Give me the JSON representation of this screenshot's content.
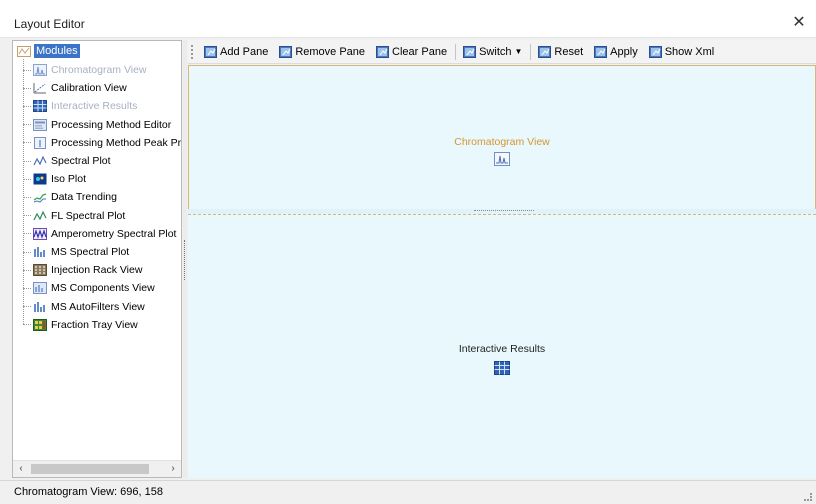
{
  "window": {
    "title": "Layout Editor",
    "close_label": "✕"
  },
  "tree": {
    "root_label": "Modules",
    "items": [
      {
        "label": "Chromatogram View",
        "icon": "chromatogram-icon",
        "disabled": true
      },
      {
        "label": "Calibration View",
        "icon": "calibration-icon",
        "disabled": false
      },
      {
        "label": "Interactive Results",
        "icon": "table-icon",
        "disabled": true
      },
      {
        "label": "Processing Method Editor",
        "icon": "method-editor-icon",
        "disabled": false
      },
      {
        "label": "Processing Method Peak Prop",
        "icon": "peak-prop-icon",
        "disabled": false
      },
      {
        "label": "Spectral Plot",
        "icon": "spectral-plot-icon",
        "disabled": false
      },
      {
        "label": "Iso Plot",
        "icon": "iso-plot-icon",
        "disabled": false
      },
      {
        "label": "Data Trending",
        "icon": "data-trending-icon",
        "disabled": false
      },
      {
        "label": "FL Spectral Plot",
        "icon": "fl-spectral-icon",
        "disabled": false
      },
      {
        "label": "Amperometry Spectral Plot",
        "icon": "amperometry-icon",
        "disabled": false
      },
      {
        "label": "MS Spectral Plot",
        "icon": "ms-spectral-icon",
        "disabled": false
      },
      {
        "label": "Injection Rack View",
        "icon": "injection-rack-icon",
        "disabled": false
      },
      {
        "label": "MS Components View",
        "icon": "ms-components-icon",
        "disabled": false
      },
      {
        "label": "MS AutoFilters View",
        "icon": "ms-autofilters-icon",
        "disabled": false
      },
      {
        "label": "Fraction Tray View",
        "icon": "fraction-tray-icon",
        "disabled": false
      }
    ],
    "scroll_left": "‹",
    "scroll_right": "›"
  },
  "toolbar": {
    "add_pane": "Add Pane",
    "remove_pane": "Remove Pane",
    "clear_pane": "Clear Pane",
    "switch": "Switch",
    "reset": "Reset",
    "apply": "Apply",
    "show_xml": "Show Xml"
  },
  "panes": {
    "top_title": "Chromatogram View",
    "bottom_title": "Interactive Results"
  },
  "status": {
    "text": "Chromatogram View: 696, 158"
  },
  "colors": {
    "selection": "#3b73c6",
    "pane_bg": "#e8f8fc",
    "pane_border": "#d9b679",
    "active_title": "#d69534",
    "disabled_text": "#a7b1c2"
  }
}
